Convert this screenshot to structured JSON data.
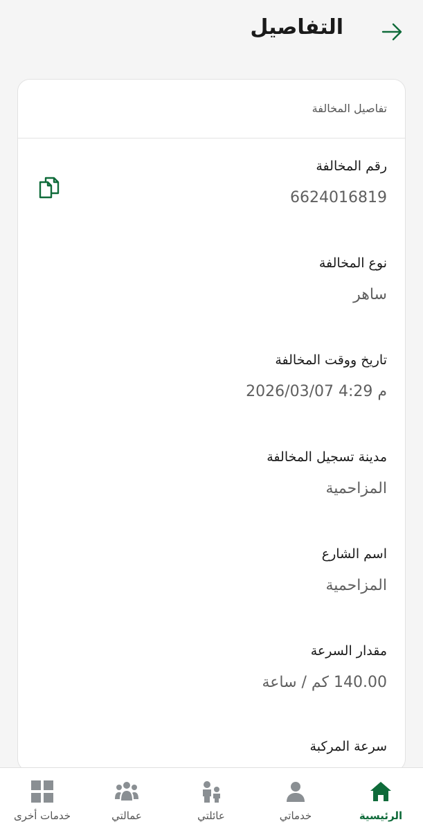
{
  "header": {
    "title": "التفاصيل"
  },
  "card": {
    "title": "تفاصيل المخالفة",
    "fields": [
      {
        "label": "رقم المخالفة",
        "value": "6624016819"
      },
      {
        "label": "نوع المخالفة",
        "value": "ساهر"
      },
      {
        "label": "تاريخ ووقت المخالفة",
        "value": "2026/03/07 4:29 م"
      },
      {
        "label": "مدينة تسجيل المخالفة",
        "value": "المزاحمية"
      },
      {
        "label": "اسم الشارع",
        "value": "المزاحمية"
      },
      {
        "label": "مقدار السرعة",
        "value": "140.00 كم / ساعة"
      },
      {
        "label": "سرعة المركبة",
        "value": ""
      }
    ]
  },
  "nav": {
    "items": [
      {
        "label": "الرئيسية",
        "icon": "home-icon",
        "active": true
      },
      {
        "label": "خدماتي",
        "icon": "person-icon",
        "active": false
      },
      {
        "label": "عائلتي",
        "icon": "family-icon",
        "active": false
      },
      {
        "label": "عمالتي",
        "icon": "workers-icon",
        "active": false
      },
      {
        "label": "خدمات أخرى",
        "icon": "grid-icon",
        "active": false
      }
    ]
  },
  "colors": {
    "accent": "#0f6b3a",
    "nav_icon": "#8a8f93"
  }
}
